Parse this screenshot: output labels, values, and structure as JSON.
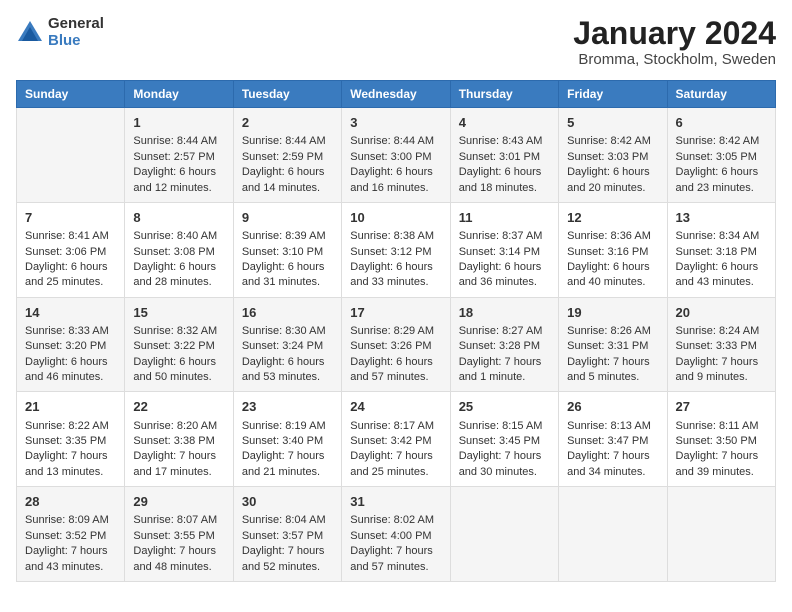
{
  "logo": {
    "general": "General",
    "blue": "Blue"
  },
  "title": "January 2024",
  "location": "Bromma, Stockholm, Sweden",
  "days_of_week": [
    "Sunday",
    "Monday",
    "Tuesday",
    "Wednesday",
    "Thursday",
    "Friday",
    "Saturday"
  ],
  "weeks": [
    [
      {
        "day": "",
        "info": ""
      },
      {
        "day": "1",
        "info": "Sunrise: 8:44 AM\nSunset: 2:57 PM\nDaylight: 6 hours\nand 12 minutes."
      },
      {
        "day": "2",
        "info": "Sunrise: 8:44 AM\nSunset: 2:59 PM\nDaylight: 6 hours\nand 14 minutes."
      },
      {
        "day": "3",
        "info": "Sunrise: 8:44 AM\nSunset: 3:00 PM\nDaylight: 6 hours\nand 16 minutes."
      },
      {
        "day": "4",
        "info": "Sunrise: 8:43 AM\nSunset: 3:01 PM\nDaylight: 6 hours\nand 18 minutes."
      },
      {
        "day": "5",
        "info": "Sunrise: 8:42 AM\nSunset: 3:03 PM\nDaylight: 6 hours\nand 20 minutes."
      },
      {
        "day": "6",
        "info": "Sunrise: 8:42 AM\nSunset: 3:05 PM\nDaylight: 6 hours\nand 23 minutes."
      }
    ],
    [
      {
        "day": "7",
        "info": "Sunrise: 8:41 AM\nSunset: 3:06 PM\nDaylight: 6 hours\nand 25 minutes."
      },
      {
        "day": "8",
        "info": "Sunrise: 8:40 AM\nSunset: 3:08 PM\nDaylight: 6 hours\nand 28 minutes."
      },
      {
        "day": "9",
        "info": "Sunrise: 8:39 AM\nSunset: 3:10 PM\nDaylight: 6 hours\nand 31 minutes."
      },
      {
        "day": "10",
        "info": "Sunrise: 8:38 AM\nSunset: 3:12 PM\nDaylight: 6 hours\nand 33 minutes."
      },
      {
        "day": "11",
        "info": "Sunrise: 8:37 AM\nSunset: 3:14 PM\nDaylight: 6 hours\nand 36 minutes."
      },
      {
        "day": "12",
        "info": "Sunrise: 8:36 AM\nSunset: 3:16 PM\nDaylight: 6 hours\nand 40 minutes."
      },
      {
        "day": "13",
        "info": "Sunrise: 8:34 AM\nSunset: 3:18 PM\nDaylight: 6 hours\nand 43 minutes."
      }
    ],
    [
      {
        "day": "14",
        "info": "Sunrise: 8:33 AM\nSunset: 3:20 PM\nDaylight: 6 hours\nand 46 minutes."
      },
      {
        "day": "15",
        "info": "Sunrise: 8:32 AM\nSunset: 3:22 PM\nDaylight: 6 hours\nand 50 minutes."
      },
      {
        "day": "16",
        "info": "Sunrise: 8:30 AM\nSunset: 3:24 PM\nDaylight: 6 hours\nand 53 minutes."
      },
      {
        "day": "17",
        "info": "Sunrise: 8:29 AM\nSunset: 3:26 PM\nDaylight: 6 hours\nand 57 minutes."
      },
      {
        "day": "18",
        "info": "Sunrise: 8:27 AM\nSunset: 3:28 PM\nDaylight: 7 hours\nand 1 minute."
      },
      {
        "day": "19",
        "info": "Sunrise: 8:26 AM\nSunset: 3:31 PM\nDaylight: 7 hours\nand 5 minutes."
      },
      {
        "day": "20",
        "info": "Sunrise: 8:24 AM\nSunset: 3:33 PM\nDaylight: 7 hours\nand 9 minutes."
      }
    ],
    [
      {
        "day": "21",
        "info": "Sunrise: 8:22 AM\nSunset: 3:35 PM\nDaylight: 7 hours\nand 13 minutes."
      },
      {
        "day": "22",
        "info": "Sunrise: 8:20 AM\nSunset: 3:38 PM\nDaylight: 7 hours\nand 17 minutes."
      },
      {
        "day": "23",
        "info": "Sunrise: 8:19 AM\nSunset: 3:40 PM\nDaylight: 7 hours\nand 21 minutes."
      },
      {
        "day": "24",
        "info": "Sunrise: 8:17 AM\nSunset: 3:42 PM\nDaylight: 7 hours\nand 25 minutes."
      },
      {
        "day": "25",
        "info": "Sunrise: 8:15 AM\nSunset: 3:45 PM\nDaylight: 7 hours\nand 30 minutes."
      },
      {
        "day": "26",
        "info": "Sunrise: 8:13 AM\nSunset: 3:47 PM\nDaylight: 7 hours\nand 34 minutes."
      },
      {
        "day": "27",
        "info": "Sunrise: 8:11 AM\nSunset: 3:50 PM\nDaylight: 7 hours\nand 39 minutes."
      }
    ],
    [
      {
        "day": "28",
        "info": "Sunrise: 8:09 AM\nSunset: 3:52 PM\nDaylight: 7 hours\nand 43 minutes."
      },
      {
        "day": "29",
        "info": "Sunrise: 8:07 AM\nSunset: 3:55 PM\nDaylight: 7 hours\nand 48 minutes."
      },
      {
        "day": "30",
        "info": "Sunrise: 8:04 AM\nSunset: 3:57 PM\nDaylight: 7 hours\nand 52 minutes."
      },
      {
        "day": "31",
        "info": "Sunrise: 8:02 AM\nSunset: 4:00 PM\nDaylight: 7 hours\nand 57 minutes."
      },
      {
        "day": "",
        "info": ""
      },
      {
        "day": "",
        "info": ""
      },
      {
        "day": "",
        "info": ""
      }
    ]
  ]
}
